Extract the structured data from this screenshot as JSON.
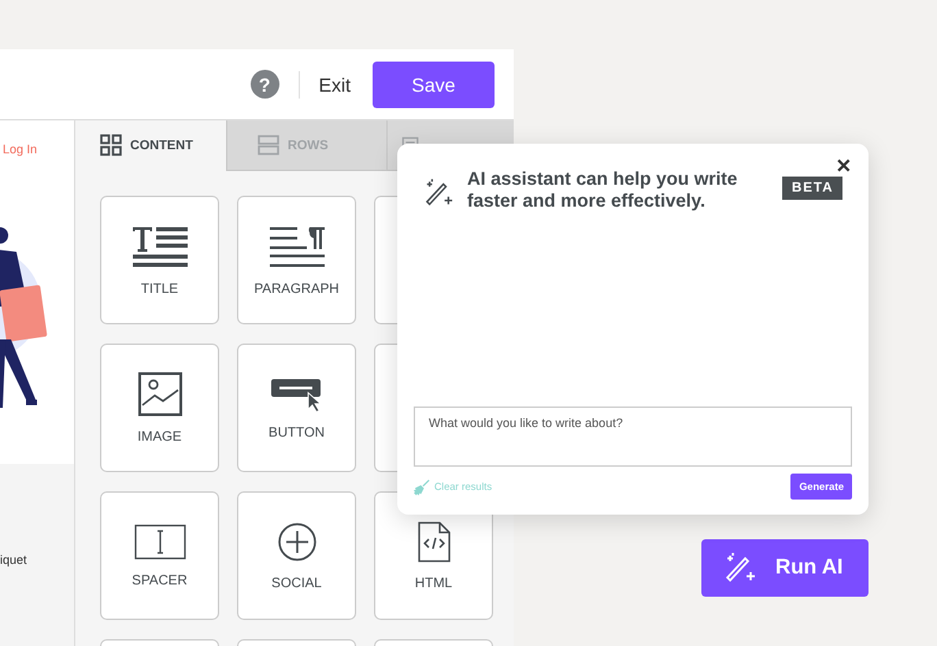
{
  "toolbar": {
    "help": "?",
    "exit": "Exit",
    "save": "Save"
  },
  "preview": {
    "login": "Log In",
    "footer_text": "iquet"
  },
  "tabs": [
    {
      "label": "CONTENT",
      "kind": "grid",
      "selected": true
    },
    {
      "label": "ROWS",
      "kind": "rows",
      "selected": false
    },
    {
      "kind": "page",
      "selected": false
    }
  ],
  "tiles": [
    {
      "kind": "title",
      "label": "TITLE"
    },
    {
      "kind": "paragraph",
      "label": "PARAGRAPH"
    },
    {
      "kind": "blank"
    },
    {
      "kind": "image",
      "label": "IMAGE"
    },
    {
      "kind": "button",
      "label": "BUTTON"
    },
    {
      "kind": "blank"
    },
    {
      "kind": "spacer",
      "label": "SPACER"
    },
    {
      "kind": "social",
      "label": "SOCIAL"
    },
    {
      "kind": "html",
      "label": "HTML"
    },
    {
      "kind": "blank"
    },
    {
      "kind": "blank"
    },
    {
      "kind": "blank"
    }
  ],
  "assistant": {
    "title": "AI assistant can help you write faster and more effectively.",
    "badge": "BETA",
    "close": "✕",
    "placeholder": "What would you like to write about?",
    "clear": "Clear results",
    "generate": "Generate"
  },
  "run_button": "Run AI"
}
